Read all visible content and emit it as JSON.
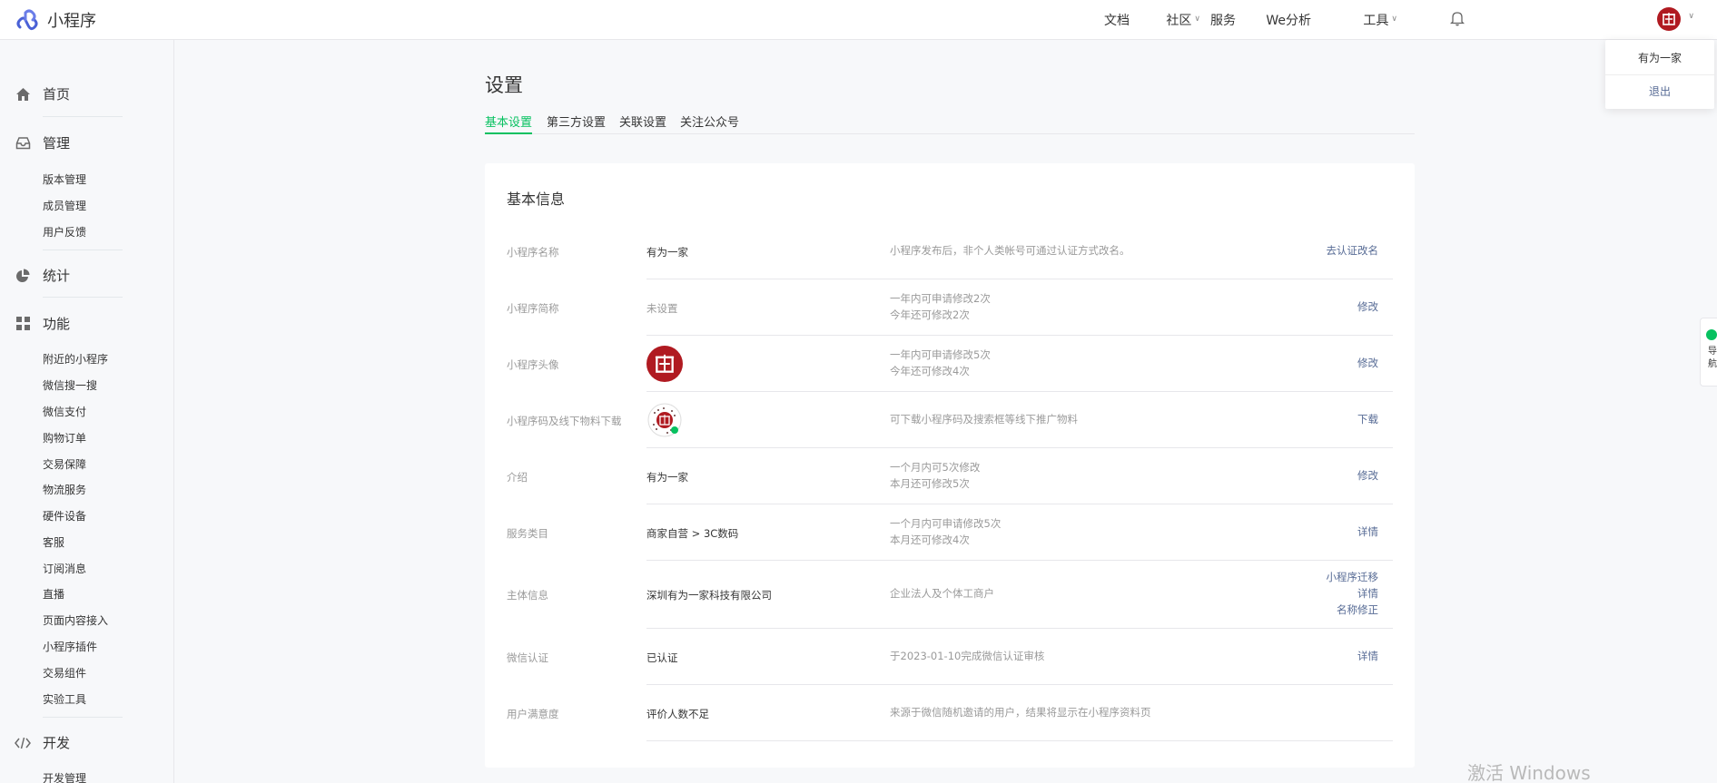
{
  "app": {
    "name": "小程序"
  },
  "topnav": {
    "docs": "文档",
    "community": "社区",
    "services": "服务",
    "analytics": "We分析",
    "tools": "工具"
  },
  "account": {
    "name": "有为一家",
    "logout": "退出"
  },
  "sidebar": {
    "home": "首页",
    "manage": {
      "label": "管理",
      "items": [
        "版本管理",
        "成员管理",
        "用户反馈"
      ]
    },
    "stats": "统计",
    "features": {
      "label": "功能",
      "items": [
        "附近的小程序",
        "微信搜一搜",
        "微信支付",
        "购物订单",
        "交易保障",
        "物流服务",
        "硬件设备",
        "客服",
        "订阅消息",
        "直播",
        "页面内容接入",
        "小程序插件",
        "交易组件",
        "实验工具"
      ]
    },
    "dev": {
      "label": "开发",
      "items": [
        "开发管理"
      ]
    }
  },
  "page": {
    "title": "设置"
  },
  "tabs": [
    "基本设置",
    "第三方设置",
    "关联设置",
    "关注公众号"
  ],
  "card": {
    "title": "基本信息",
    "rows": [
      {
        "label": "小程序名称",
        "value": "有为一家",
        "desc": [
          "小程序发布后，非个人类帐号可通过认证方式改名。"
        ],
        "actions": [
          "去认证改名"
        ]
      },
      {
        "label": "小程序简称",
        "value": "未设置",
        "desc": [
          "一年内可申请修改2次",
          "今年还可修改2次"
        ],
        "actions": [
          "修改"
        ]
      },
      {
        "label": "小程序头像",
        "value": "",
        "desc": [
          "一年内可申请修改5次",
          "今年还可修改4次"
        ],
        "actions": [
          "修改"
        ]
      },
      {
        "label": "小程序码及线下物料下载",
        "value": "",
        "desc": [
          "可下载小程序码及搜索框等线下推广物料"
        ],
        "actions": [
          "下载"
        ]
      },
      {
        "label": "介绍",
        "value": "有为一家",
        "desc": [
          "一个月内可5次修改",
          "本月还可修改5次"
        ],
        "actions": [
          "修改"
        ]
      },
      {
        "label": "服务类目",
        "value": "商家自营 > 3C数码",
        "desc": [
          "一个月内可申请修改5次",
          "本月还可修改4次"
        ],
        "actions": [
          "详情"
        ]
      },
      {
        "label": "主体信息",
        "value": "深圳有为一家科技有限公司",
        "desc": [
          "企业法人及个体工商户"
        ],
        "actions": [
          "小程序迁移",
          "详情",
          "名称修正"
        ]
      },
      {
        "label": "微信认证",
        "value": "已认证",
        "desc": [
          "于2023-01-10完成微信认证审核"
        ],
        "actions": [
          "详情"
        ]
      },
      {
        "label": "用户满意度",
        "value": "评价人数不足",
        "desc": [
          "来源于微信随机邀请的用户，结果将显示在小程序资料页"
        ],
        "actions": []
      }
    ]
  },
  "float_widget": {
    "text": "导航"
  },
  "watermark": "激活 Windows",
  "colors": {
    "accent": "#07c160",
    "link": "#576b95",
    "brand_red": "#b01a21"
  }
}
